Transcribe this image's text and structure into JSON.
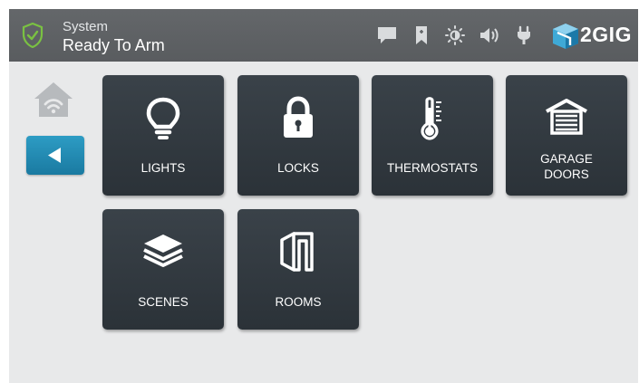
{
  "status": {
    "title": "System",
    "value": "Ready To Arm"
  },
  "header_icons": [
    "chat-icon",
    "bookmark-icon",
    "brightness-icon",
    "volume-icon",
    "power-plug-icon"
  ],
  "brand": {
    "name": "2GIG"
  },
  "nav": {
    "home_icon": "home-wifi-icon",
    "back_icon": "back-arrow-icon"
  },
  "tiles": [
    {
      "label": "LIGHTS",
      "icon": "lightbulb-icon"
    },
    {
      "label": "LOCKS",
      "icon": "padlock-icon"
    },
    {
      "label": "THERMOSTATS",
      "icon": "thermometer-icon"
    },
    {
      "label": "GARAGE\nDOORS",
      "icon": "garage-icon"
    },
    {
      "label": "SCENES",
      "icon": "layers-icon"
    },
    {
      "label": "ROOMS",
      "icon": "rooms-icon"
    }
  ],
  "colors": {
    "header": "#5f6265",
    "tile": "#323a40",
    "accent": "#1f8ab4",
    "shield": "#7ac142",
    "background": "#e8e9ea"
  }
}
